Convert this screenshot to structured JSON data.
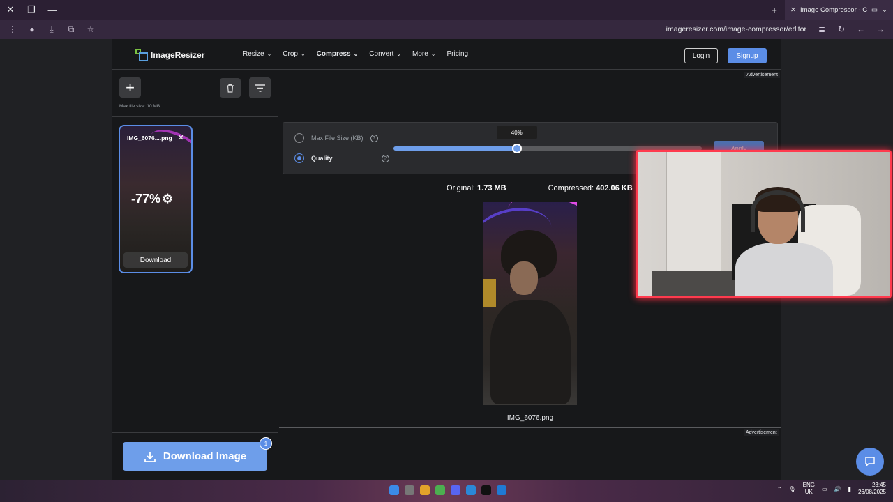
{
  "browser": {
    "tab_title": "Image Compressor - Compress",
    "url": "imageresizer.com/image-compressor/editor"
  },
  "site": {
    "logo_text": "ImageResizer",
    "nav": [
      {
        "label": "Resize",
        "dropdown": true
      },
      {
        "label": "Crop",
        "dropdown": true
      },
      {
        "label": "Compress",
        "dropdown": true,
        "active": true
      },
      {
        "label": "Convert",
        "dropdown": true
      },
      {
        "label": "More",
        "dropdown": true
      },
      {
        "label": "Pricing",
        "dropdown": false
      }
    ],
    "login_label": "Login",
    "signup_label": "Signup"
  },
  "left_panel": {
    "max_file_size": "Max file size: 10 MB",
    "thumb": {
      "name": "IMG_6076....png",
      "reduction": "-77%",
      "download_label": "Download"
    },
    "download_image_label": "Download Image",
    "badge_count": "1"
  },
  "ads": {
    "label": "Advertisement"
  },
  "controls": {
    "max_file_size_label": "Max File Size (KB)",
    "quality_label": "Quality",
    "selected": "quality",
    "quality_value": 0.4,
    "quality_text": "40%",
    "apply_label": "Apply"
  },
  "result": {
    "original_label": "Original:",
    "original_value": "1.73 MB",
    "compressed_label": "Compressed:",
    "compressed_value": "402.06 KB",
    "file_name": "IMG_6076.png"
  },
  "taskbar": {
    "lang_line1": "ENG",
    "lang_line2": "UK",
    "time": "23:45",
    "date": "26/08/2025"
  },
  "colors": {
    "accent": "#5b8de6",
    "webcam_border": "#ff3b4e"
  }
}
